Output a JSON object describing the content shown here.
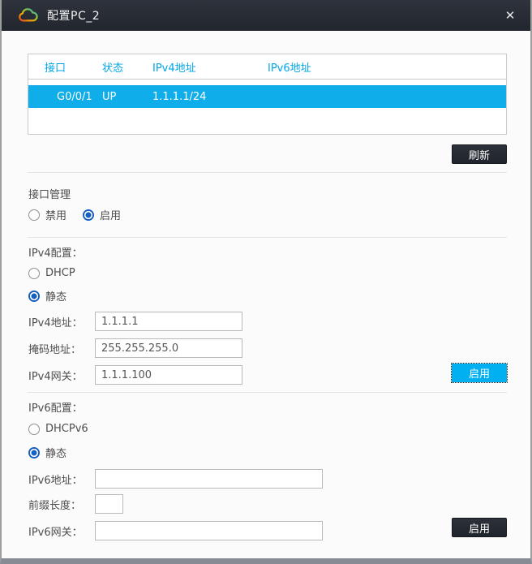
{
  "window": {
    "title": "配置PC_2"
  },
  "icons": {
    "close": "✕",
    "logo": "ensp-cloud"
  },
  "table": {
    "headers": [
      "接口",
      "状态",
      "IPv4地址",
      "IPv6地址"
    ],
    "row": {
      "interface": "G0/0/1",
      "status": "UP",
      "ipv4": "1.1.1.1/24",
      "ipv6": ""
    }
  },
  "buttons": {
    "refresh": "刷新",
    "ipv4_enable": "启用",
    "ipv6_enable": "启用"
  },
  "interface_mgmt": {
    "title": "接口管理",
    "options": [
      {
        "label": "禁用",
        "selected": false
      },
      {
        "label": "启用",
        "selected": true
      }
    ]
  },
  "ipv4": {
    "title": "IPv4配置：",
    "options": [
      {
        "label": "DHCP",
        "selected": false
      },
      {
        "label": "静态",
        "selected": true
      }
    ],
    "fields": [
      {
        "label": "IPv4地址：",
        "value": "1.1.1.1"
      },
      {
        "label": "掩码地址：",
        "value": "255.255.255.0"
      },
      {
        "label": "IPv4网关：",
        "value": "1.1.1.100"
      }
    ]
  },
  "ipv6": {
    "title": "IPv6配置：",
    "options": [
      {
        "label": "DHCPv6",
        "selected": false
      },
      {
        "label": "静态",
        "selected": true
      }
    ],
    "fields": [
      {
        "label": "IPv6地址：",
        "value": ""
      },
      {
        "label": "前缀长度：",
        "value": ""
      },
      {
        "label": "IPv6网关：",
        "value": ""
      }
    ]
  },
  "colors": {
    "accent_cyan": "#0faeea",
    "header_text": "#00a6e8",
    "radio_selected": "#1560c0",
    "titlebar": "#262b33",
    "button_dark": "#232832"
  }
}
